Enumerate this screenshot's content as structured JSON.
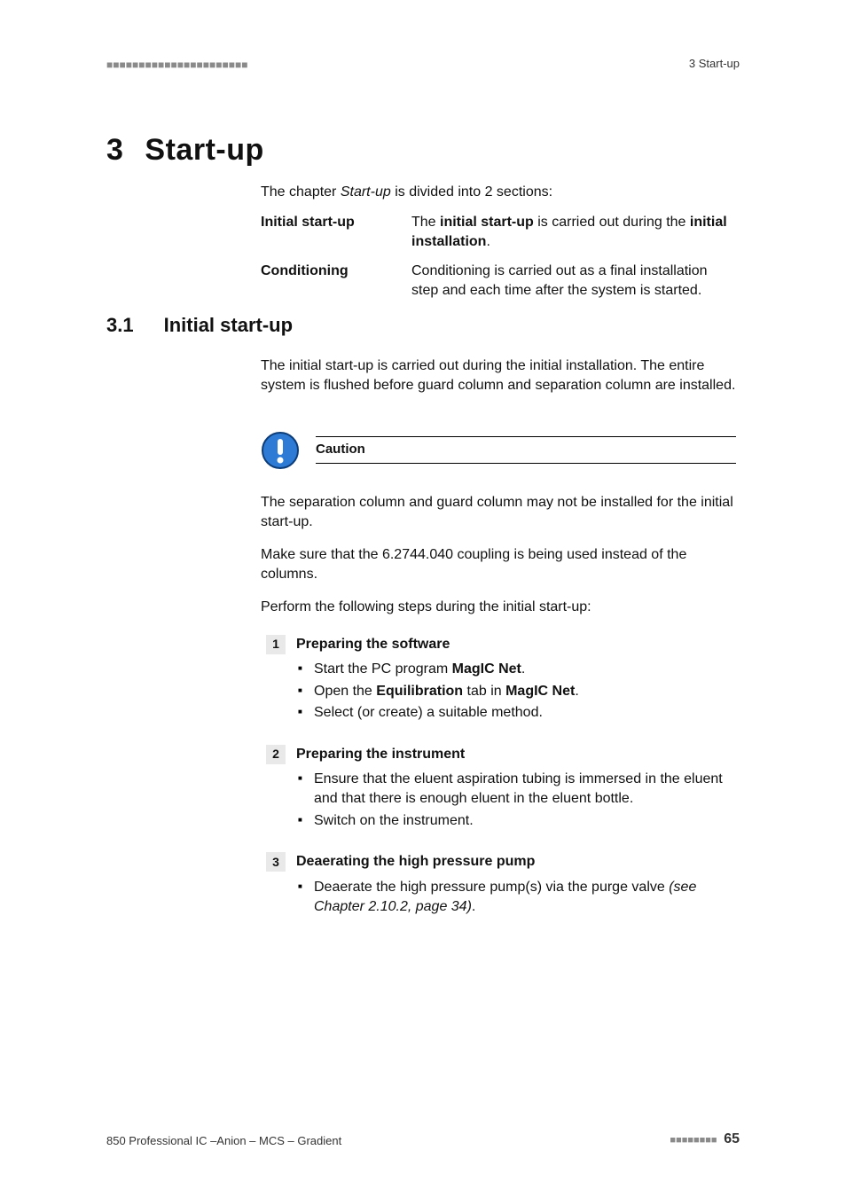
{
  "header": {
    "ticks": "■■■■■■■■■■■■■■■■■■■■■■",
    "right": "3 Start-up"
  },
  "chapter": {
    "number": "3",
    "title": "Start-up"
  },
  "intro": {
    "prefix": "The chapter ",
    "italic": "Start-up",
    "suffix": " is divided into 2 sections:"
  },
  "defs": [
    {
      "term": "Initial start-up",
      "prefix": "The ",
      "bold1": "initial start-up",
      "mid": " is carried out during the ",
      "bold2": "initial installation",
      "suffix": "."
    },
    {
      "term": "Conditioning",
      "plain": "Conditioning is carried out as a final installation step and each time after the system is started."
    }
  ],
  "section": {
    "number": "3.1",
    "title": "Initial start-up"
  },
  "body1": "The initial start-up is carried out during the initial installation. The entire system is flushed before guard column and separation column are installed.",
  "caution": {
    "label": "Caution",
    "p1": "The separation column and guard column may not be installed for the initial start-up.",
    "p2": "Make sure that the 6.2744.040 coupling is being used instead of the columns."
  },
  "body2": "Perform the following steps during the initial start-up:",
  "steps": [
    {
      "num": "1",
      "title": "Preparing the software",
      "items": [
        {
          "pre": "Start the PC program ",
          "bold": "MagIC Net",
          "post": "."
        },
        {
          "pre": "Open the ",
          "bold": "Equilibration",
          "mid": " tab in ",
          "bold2": "MagIC Net",
          "post": "."
        },
        {
          "plain": "Select (or create) a suitable method."
        }
      ]
    },
    {
      "num": "2",
      "title": "Preparing the instrument",
      "items": [
        {
          "plain": "Ensure that the eluent aspiration tubing is immersed in the eluent and that there is enough eluent in the eluent bottle."
        },
        {
          "plain": "Switch on the instrument."
        }
      ]
    },
    {
      "num": "3",
      "title": "Deaerating the high pressure pump",
      "items": [
        {
          "pre": "Deaerate the high pressure pump(s) via the purge valve ",
          "italic": "(see Chapter 2.10.2, page 34)",
          "post": "."
        }
      ]
    }
  ],
  "footer": {
    "left": "850 Professional IC –Anion – MCS – Gradient",
    "ticks": "■■■■■■■■",
    "page": "65"
  }
}
